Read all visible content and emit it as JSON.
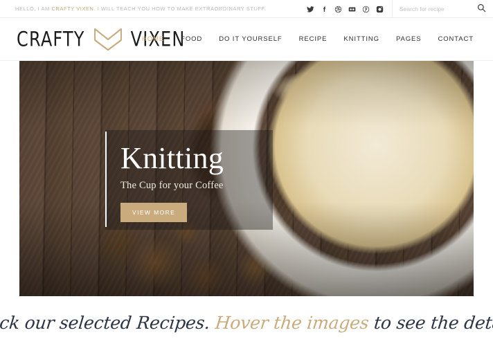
{
  "topbar": {
    "tagline_prefix": "HELLO, I AM ",
    "tagline_brand": "CRAFTY VIXEN",
    "tagline_suffix": ". I WILL TEACH YOU HOW TO MAKE EXTRAORDINARY STUFF.",
    "social": [
      {
        "name": "twitter-icon",
        "label": "Twitter"
      },
      {
        "name": "facebook-icon",
        "label": "Facebook"
      },
      {
        "name": "dribbble-icon",
        "label": "Dribbble"
      },
      {
        "name": "flickr-icon",
        "label": "Flickr"
      },
      {
        "name": "pinterest-icon",
        "label": "Pinterest"
      },
      {
        "name": "instagram-icon",
        "label": "Instagram"
      }
    ],
    "search": {
      "placeholder": "Search for recipe",
      "value": "",
      "button_label": "Search"
    }
  },
  "header": {
    "logo": {
      "word_left": "CRAFTY",
      "word_right": "VIXEN",
      "mark_name": "fox-bowtie-logo-icon"
    },
    "nav": [
      {
        "label": "HOME",
        "active": true
      },
      {
        "label": "FOOD",
        "active": false
      },
      {
        "label": "DO IT YOURSELF",
        "active": false
      },
      {
        "label": "RECIPE",
        "active": false
      },
      {
        "label": "KNITTING",
        "active": false
      },
      {
        "label": "PAGES",
        "active": false
      },
      {
        "label": "CONTACT",
        "active": false
      }
    ]
  },
  "hero": {
    "title": "Knitting",
    "subtitle": "The Cup for your Coffee",
    "cta_label": "VIEW MORE"
  },
  "tagline": {
    "part1": "Check our selected Recipes. ",
    "highlight": "Hover the images",
    "part2": " to see the details."
  },
  "colors": {
    "accent": "#c9ab7e",
    "nav_active": "#d5b784",
    "text_dark": "#2e2e2e",
    "tagline_dark": "#2b3445",
    "topbar_muted": "#b9b9b9"
  }
}
